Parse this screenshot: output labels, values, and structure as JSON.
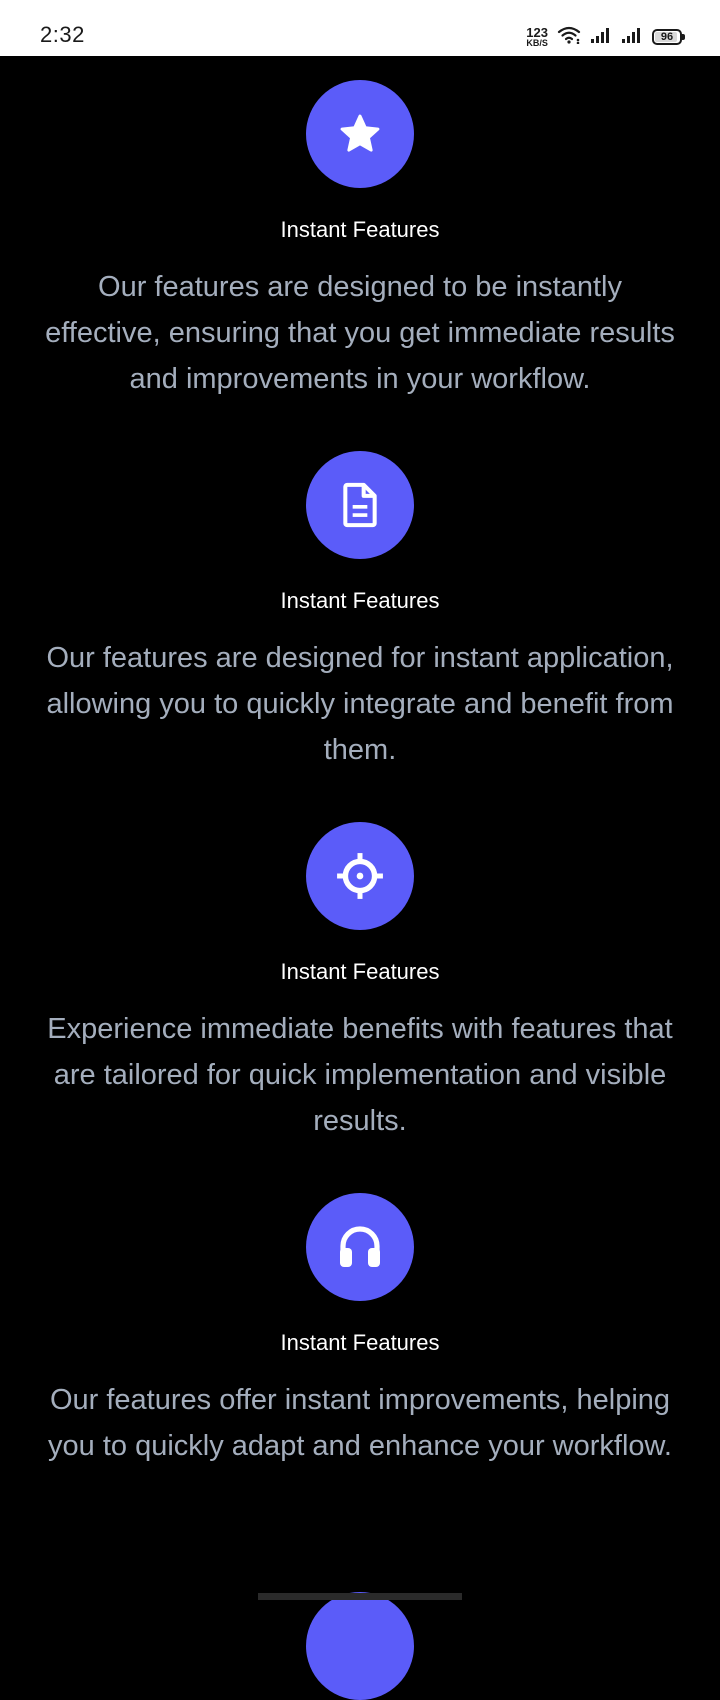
{
  "status_bar": {
    "time": "2:32",
    "net_speed_value": "123",
    "net_speed_unit": "KB/S",
    "battery": "96"
  },
  "features": [
    {
      "icon": "star-icon",
      "title": "Instant Features",
      "description": "Our features are designed to be instantly effective, ensuring that you get immediate results and improvements in your workflow."
    },
    {
      "icon": "document-icon",
      "title": "Instant Features",
      "description": "Our features are designed for instant application, allowing you to quickly integrate and benefit from them."
    },
    {
      "icon": "crosshair-icon",
      "title": "Instant Features",
      "description": "Experience immediate benefits with features that are tailored for quick implementation and visible results."
    },
    {
      "icon": "headphones-icon",
      "title": "Instant Features",
      "description": "Our features offer instant improvements, helping you to quickly adapt and enhance your workflow."
    }
  ],
  "colors": {
    "background": "#000000",
    "accent": "#5b5cf9",
    "title": "#ffffff",
    "description": "#a4aebd"
  }
}
